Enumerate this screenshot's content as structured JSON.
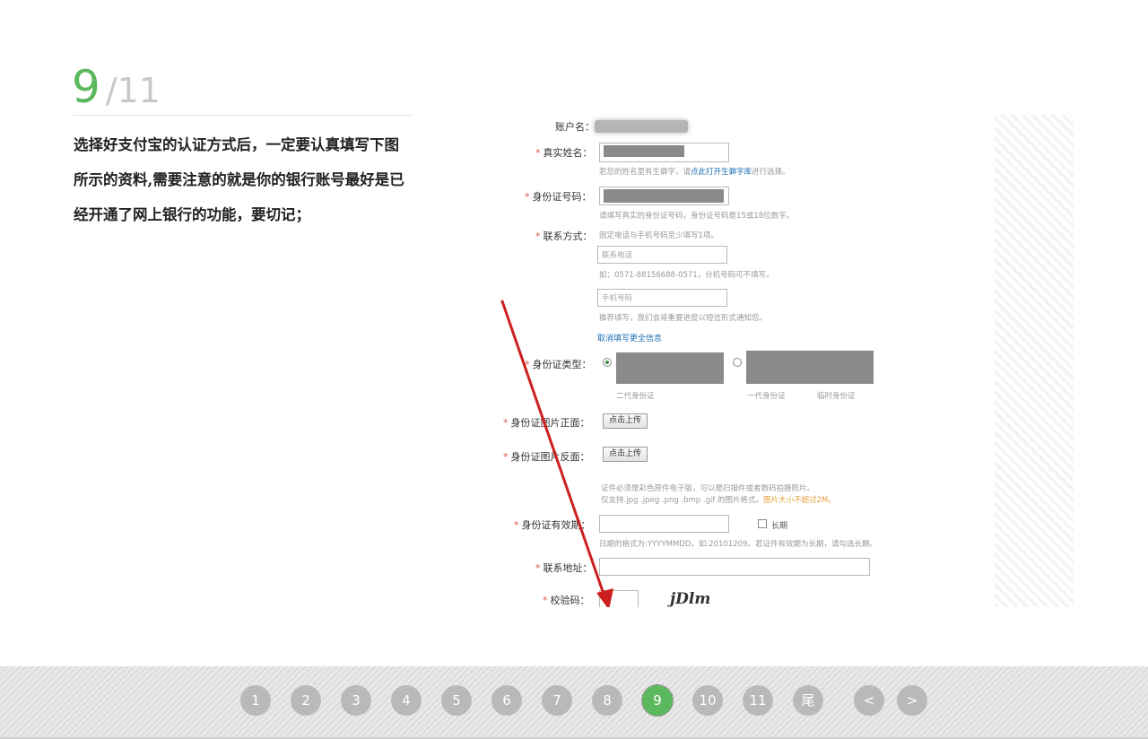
{
  "slide": {
    "current": "9",
    "total_text": "/11"
  },
  "description": "选择好支付宝的认证方式后，一定要认真填写下图所示的资料,需要注意的就是你的银行账号最好是已经开通了网上银行的功能，要切记；",
  "form_shot": {
    "account_label": "账户名：",
    "realname_label": "真实姓名：",
    "realname_hint_pre": "若您的姓名里有生僻字，请",
    "realname_hint_link": "点此打开生僻字库",
    "realname_hint_post": "进行选择。",
    "idnum_label": "身份证号码：",
    "idnum_hint": "请填写真实的身份证号码，身份证号码是15或18位数字。",
    "contact_label": "联系方式：",
    "contact_hint": "固定电话与手机号码至少填写1项。",
    "phone_placeholder": "联系电话",
    "phone_hint": "如：0571-88156688-0571，分机号码可不填写。",
    "mobile_placeholder": "手机号码",
    "mobile_hint": "推荐填写，我们会将重要进度以短信形式通知您。",
    "more_link": "取消填写更全信息",
    "idtype_label": "身份证类型：",
    "idtype_opt1": "二代身份证",
    "idtype_opt2": "一代身份证",
    "idtype_opt3": "临时身份证",
    "front_label": "身份证图片正面：",
    "back_label": "身份证图片反面：",
    "upload_btn": "点击上传",
    "upload_hint1": "证件必须是彩色原件电子版，可以是扫描件或者数码拍摄照片。",
    "upload_hint2_pre": "仅支持.jpg .jpeg .png .bmp .gif 的图片格式。",
    "upload_hint2_warn": "图片大小不超过2M。",
    "validity_label": "身份证有效期：",
    "longterm_label": "长期",
    "validity_hint": "日期的格式为:YYYYMMDD，如:20101209。若证件有效期为长期，请勾选长期。",
    "address_label": "联系地址：",
    "captcha_label": "校验码：",
    "captcha_text": "jDlm"
  },
  "pager": {
    "items": [
      "1",
      "2",
      "3",
      "4",
      "5",
      "6",
      "7",
      "8",
      "9",
      "10",
      "11",
      "尾"
    ],
    "active": "9",
    "prev": "<",
    "next": ">"
  },
  "colors": {
    "accent": "#5cb85c",
    "pager_bg": "#b9b9b9",
    "arrow": "#cc1f1f"
  }
}
